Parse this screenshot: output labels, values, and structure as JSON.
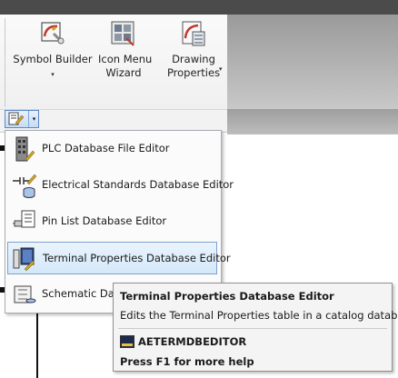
{
  "ribbon": {
    "buttons": [
      {
        "label_line1": "Symbol Builder",
        "label_line2": "",
        "has_dropdown": true,
        "icon": "symbol-builder-icon"
      },
      {
        "label_line1": "Icon Menu",
        "label_line2": "Wizard",
        "has_dropdown": false,
        "icon": "icon-menu-wizard-icon"
      },
      {
        "label_line1": "Drawing",
        "label_line2": "Properties",
        "has_dropdown": true,
        "icon": "drawing-properties-icon"
      }
    ],
    "dropdown_arrow": "▾"
  },
  "menu": {
    "items": [
      {
        "label": "PLC Database File Editor",
        "icon": "plc-database-icon",
        "highlighted": false
      },
      {
        "label": "Electrical Standards Database Editor",
        "icon": "electrical-standards-icon",
        "highlighted": false
      },
      {
        "label": "Pin List Database Editor",
        "icon": "pin-list-icon",
        "highlighted": false
      },
      {
        "label": "Terminal Properties Database Editor",
        "icon": "terminal-properties-icon",
        "highlighted": true
      },
      {
        "label": "Schematic Data",
        "icon": "schematic-icon",
        "highlighted": false
      }
    ]
  },
  "tooltip": {
    "title": "Terminal Properties Database Editor",
    "description": "Edits the Terminal Properties table in a catalog database",
    "command": "AETERMDBEDITOR",
    "help": "Press F1 for more help"
  },
  "colors": {
    "topbar": "#4b4b4b",
    "highlight_border": "#7da2ce",
    "accent_red": "#c0392b"
  }
}
